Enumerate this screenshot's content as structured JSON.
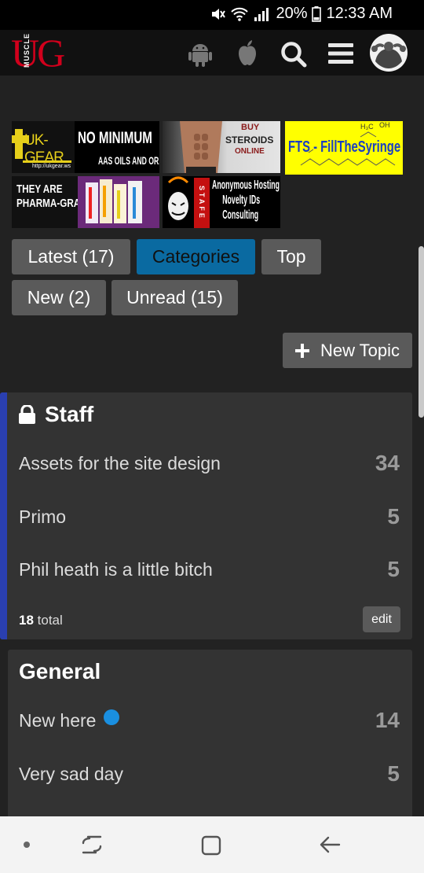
{
  "status": {
    "percent": "20%",
    "time": "12:33 AM"
  },
  "logo": {
    "letters": "UG",
    "word": "MUSCLE"
  },
  "banners": {
    "ukgear": {
      "brand": "UK-GEAR",
      "url": "http://ukgear.ws"
    },
    "nominimum": {
      "line1": "NO MINIMUM",
      "line2": "AAS OILS AND ORALS"
    },
    "steroids": {
      "line1": "BUY",
      "line2": "STEROIDS",
      "line3": "ONLINE"
    },
    "fts": {
      "text": "FTS - FillTheSyringe",
      "h3c": "H₃C",
      "oh": "OH"
    },
    "pharma": {
      "line1": "THEY ARE",
      "line2": "PHARMA-GRADE"
    },
    "hosting": {
      "stafe": "STAFE",
      "line1": "Anonymous Hosting",
      "line2": "Novelty IDs",
      "line3": "Consulting"
    }
  },
  "nav": {
    "latest": "Latest (17)",
    "categories": "Categories",
    "top": "Top",
    "new": "New (2)",
    "unread": "Unread (15)"
  },
  "new_topic": {
    "label": "New Topic"
  },
  "staff": {
    "title": "Staff",
    "topics": [
      {
        "title": "Assets for the site design",
        "count": "34"
      },
      {
        "title": "Primo",
        "count": "5"
      },
      {
        "title": "Phil heath is a little bitch",
        "count": "5"
      }
    ],
    "total_num": "18",
    "total_word": "total",
    "edit": "edit",
    "accent": "#2a3fb0"
  },
  "general": {
    "title": "General",
    "topics": [
      {
        "title": "New here",
        "count": "14"
      },
      {
        "title": "Very sad day",
        "count": "5"
      }
    ]
  },
  "colors": {
    "active_tab": "#0a6aa1",
    "unread_dot": "#1a8fe0"
  }
}
